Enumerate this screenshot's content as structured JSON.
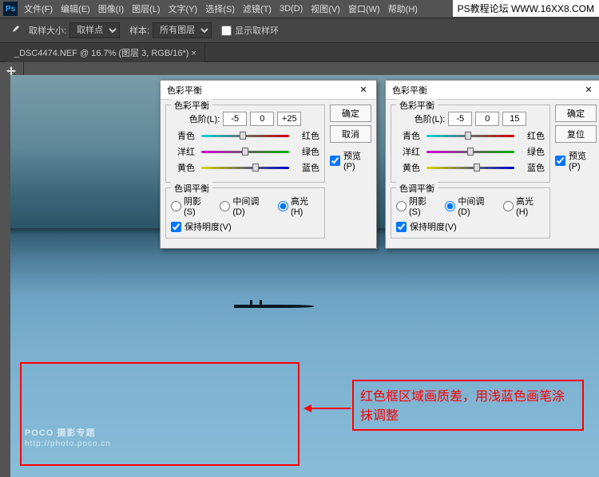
{
  "watermark": "PS教程论坛  WWW.16XX8.COM",
  "menu": {
    "file": "文件(F)",
    "edit": "编辑(E)",
    "image": "图像(I)",
    "layer": "图层(L)",
    "type": "文字(Y)",
    "select": "选择(S)",
    "filter": "滤镜(T)",
    "threeD": "3D(D)",
    "view": "视图(V)",
    "window": "窗口(W)",
    "help": "帮助(H)"
  },
  "opt": {
    "sampleSizeLbl": "取样大小:",
    "sampleSizeVal": "取样点",
    "sampleLbl": "样本:",
    "sampleVal": "所有图层",
    "showRingLbl": "显示取样环"
  },
  "tab": {
    "title": "_DSC4474.NEF @ 16.7% (图层 3, RGB/16*) ×"
  },
  "annot": {
    "text": "红色框区域画质差，用浅蓝色画笔涂抹调整"
  },
  "poco": {
    "brand": "POCO 摄影专题",
    "url": "http://photo.poco.cn"
  },
  "dlg": {
    "title": "色彩平衡",
    "ok": "确定",
    "cancel": "取消",
    "reset": "复位",
    "previewLbl": "预览(P)",
    "grpBalance": "色彩平衡",
    "grpTone": "色调平衡",
    "levelsLbl": "色阶(L):",
    "cyan": "青色",
    "red": "红色",
    "magenta": "洋红",
    "green": "绿色",
    "yellow": "黄色",
    "blue": "蓝色",
    "shadows": "阴影(S)",
    "midtones": "中间调(D)",
    "highlights": "高光(H)",
    "preserveLum": "保持明度(V)"
  },
  "d1": {
    "v1": "-5",
    "v2": "0",
    "v3": "+25",
    "tone": "highlights",
    "preview": true,
    "lum": true,
    "th": [
      47,
      50,
      62
    ]
  },
  "d2": {
    "v1": "-5",
    "v2": "0",
    "v3": "15",
    "tone": "midtones",
    "preview": true,
    "lum": true,
    "th": [
      47,
      50,
      57
    ]
  }
}
